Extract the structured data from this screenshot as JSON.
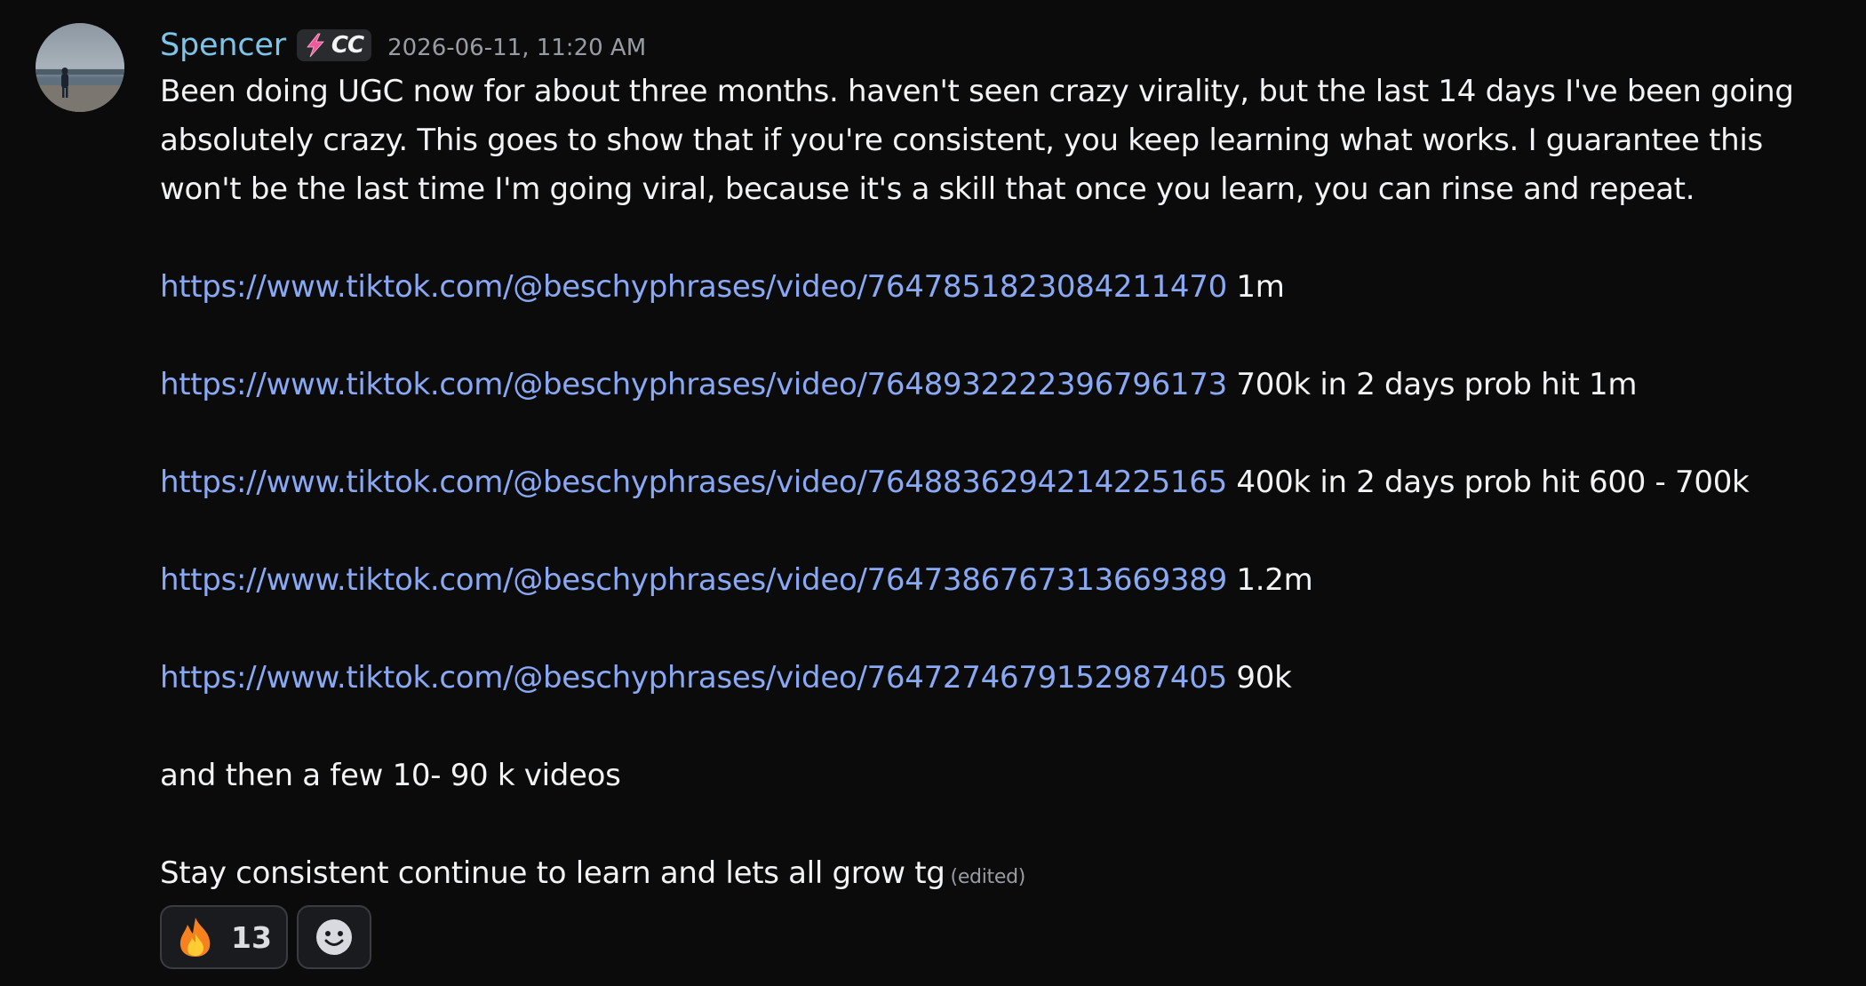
{
  "message": {
    "username": "Spencer",
    "role_badge": {
      "icon": "lightning-bolt-icon",
      "text": "CC"
    },
    "timestamp": "2026-06-11, 11:20 AM",
    "intro": "Been doing UGC now for about three months. haven't seen crazy virality, but the last 14 days I've been going absolutely crazy. This goes to show that if you're consistent, you keep learning what works. I guarantee this won't be the last time I'm going viral, because it's a skill that once you learn, you can rinse and repeat.",
    "links": [
      {
        "url": "https://www.tiktok.com/@beschyphrases/video/7647851823084211470",
        "note": "1m"
      },
      {
        "url": "https://www.tiktok.com/@beschyphrases/video/7648932222396796173",
        "note": "700k in 2 days prob hit 1m"
      },
      {
        "url": "https://www.tiktok.com/@beschyphrases/video/7648836294214225165",
        "note": "400k in 2 days prob hit 600 - 700k"
      },
      {
        "url": "https://www.tiktok.com/@beschyphrases/video/7647386767313669389",
        "note": "1.2m"
      },
      {
        "url": "https://www.tiktok.com/@beschyphrases/video/7647274679152987405",
        "note": "90k"
      }
    ],
    "extra": "and then a few 10- 90 k videos",
    "closing": "Stay consistent continue to learn and lets all grow tg",
    "edited_label": "(edited)",
    "reactions": [
      {
        "emoji": "fire-icon",
        "count": "13"
      }
    ],
    "add_reaction_icon": "smiley-face-icon",
    "colors": {
      "username": "#7cc5e8",
      "link": "#8aa9f4",
      "background": "#0b0b0c"
    }
  }
}
